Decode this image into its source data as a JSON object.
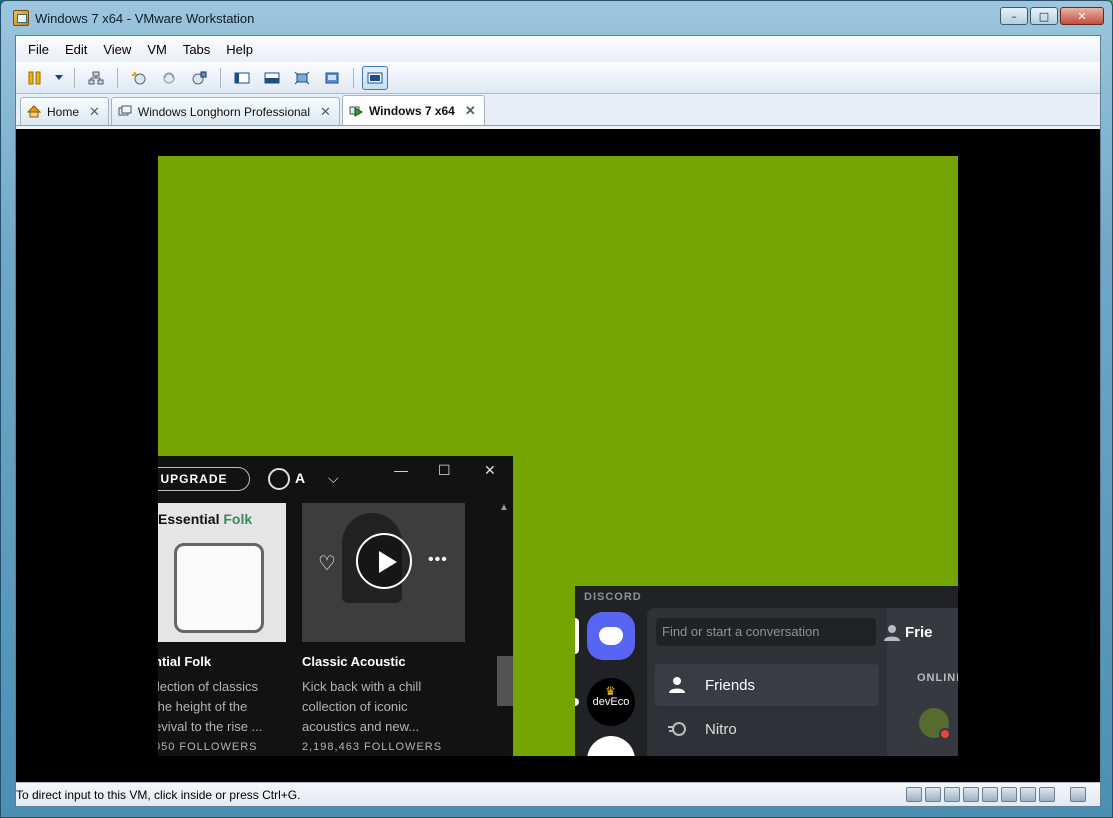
{
  "window": {
    "title": "Windows 7 x64 - VMware Workstation",
    "controls": {
      "minimize": "–",
      "maximize": "□",
      "close": "✕"
    }
  },
  "menu": [
    "File",
    "Edit",
    "View",
    "VM",
    "Tabs",
    "Help"
  ],
  "toolbar": {
    "icons": [
      "power-icon",
      "dropdown-arrow-icon",
      "network-icon",
      "snapshot-take-icon",
      "snapshot-revert-icon",
      "snapshot-manager-icon",
      "view-console-icon",
      "view-quick-switch-icon",
      "view-fullscreen-icon",
      "view-unity-icon",
      "view-stretch-icon"
    ]
  },
  "tabs": [
    {
      "label": "Home",
      "close": "✕",
      "active": false,
      "icon": "home-icon"
    },
    {
      "label": "Windows Longhorn Professional",
      "close": "✕",
      "active": false,
      "icon": "vm-icon"
    },
    {
      "label": "Windows 7 x64",
      "close": "✕",
      "active": true,
      "icon": "vm-running-icon"
    }
  ],
  "guest": {
    "desktop_color": "#74a400",
    "spotify": {
      "upgrade": "UPGRADE",
      "user_initial": "A",
      "chevron": "⌵",
      "window_controls": [
        "—",
        "☐",
        "✕"
      ],
      "cards": [
        {
          "image_title_part1": "Essential ",
          "image_title_part2": "Folk",
          "name": "ntial Folk",
          "description": "llection of classics\n the height of the\nevival to the rise ...",
          "followers": "050 FOLLOWERS"
        },
        {
          "name": "Classic Acoustic",
          "description": "Kick back with a chill\ncollection of iconic\nacoustics and new...",
          "followers": "2,198,463 FOLLOWERS"
        }
      ],
      "heart": "♡",
      "more": "•••"
    },
    "discord": {
      "brand": "DISCORD",
      "search_placeholder": "Find or start a conversation",
      "nav": [
        {
          "label": "Friends",
          "active": true
        },
        {
          "label": "Nitro",
          "active": false
        }
      ],
      "server_deveco": "devEco",
      "crown": "♛",
      "header": "Frie",
      "online_label": "ONLINE"
    }
  },
  "statusbar": {
    "message": "To direct input to this VM, click inside or press Ctrl+G."
  }
}
